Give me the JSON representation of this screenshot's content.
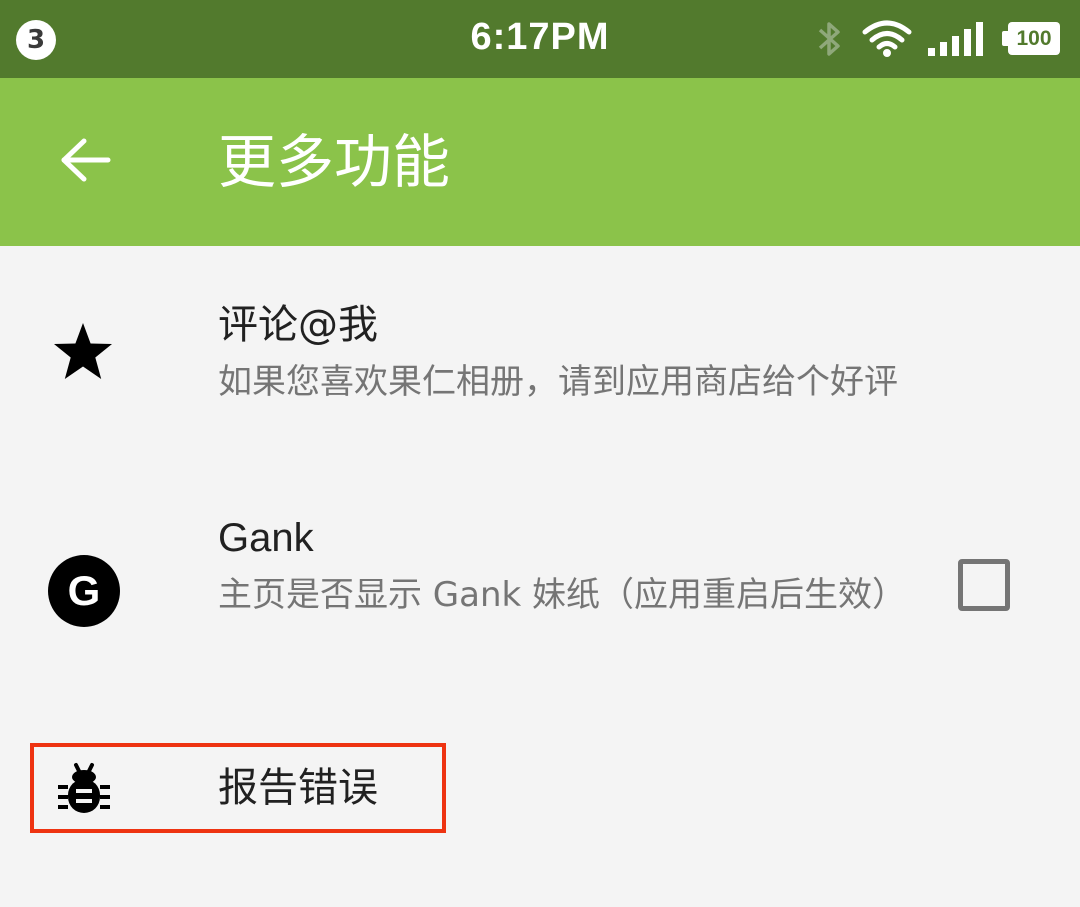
{
  "status_bar": {
    "notification_count": "3",
    "time": "6:17PM",
    "battery_level": "100",
    "icons": [
      "bluetooth-icon",
      "wifi-icon",
      "signal-icon",
      "battery-icon"
    ]
  },
  "app_bar": {
    "title": "更多功能",
    "back_icon": "arrow-back-icon",
    "color": "#8bc34a"
  },
  "list": {
    "items": [
      {
        "title": "评论@我",
        "summary": "如果您喜欢果仁相册，请到应用商店给个好评",
        "icon": "star-icon"
      },
      {
        "title": "Gank",
        "summary": "主页是否显示 Gank 妹纸（应用重启后生效）",
        "icon": "g-logo-icon",
        "icon_letter": "G",
        "checked": false
      },
      {
        "title": "报告错误",
        "icon": "bug-icon",
        "highlighted": true
      }
    ]
  },
  "colors": {
    "status_bar": "#527a2d",
    "app_bar": "#8bc34a",
    "background": "#f4f4f4",
    "highlight": "#ee3311"
  }
}
